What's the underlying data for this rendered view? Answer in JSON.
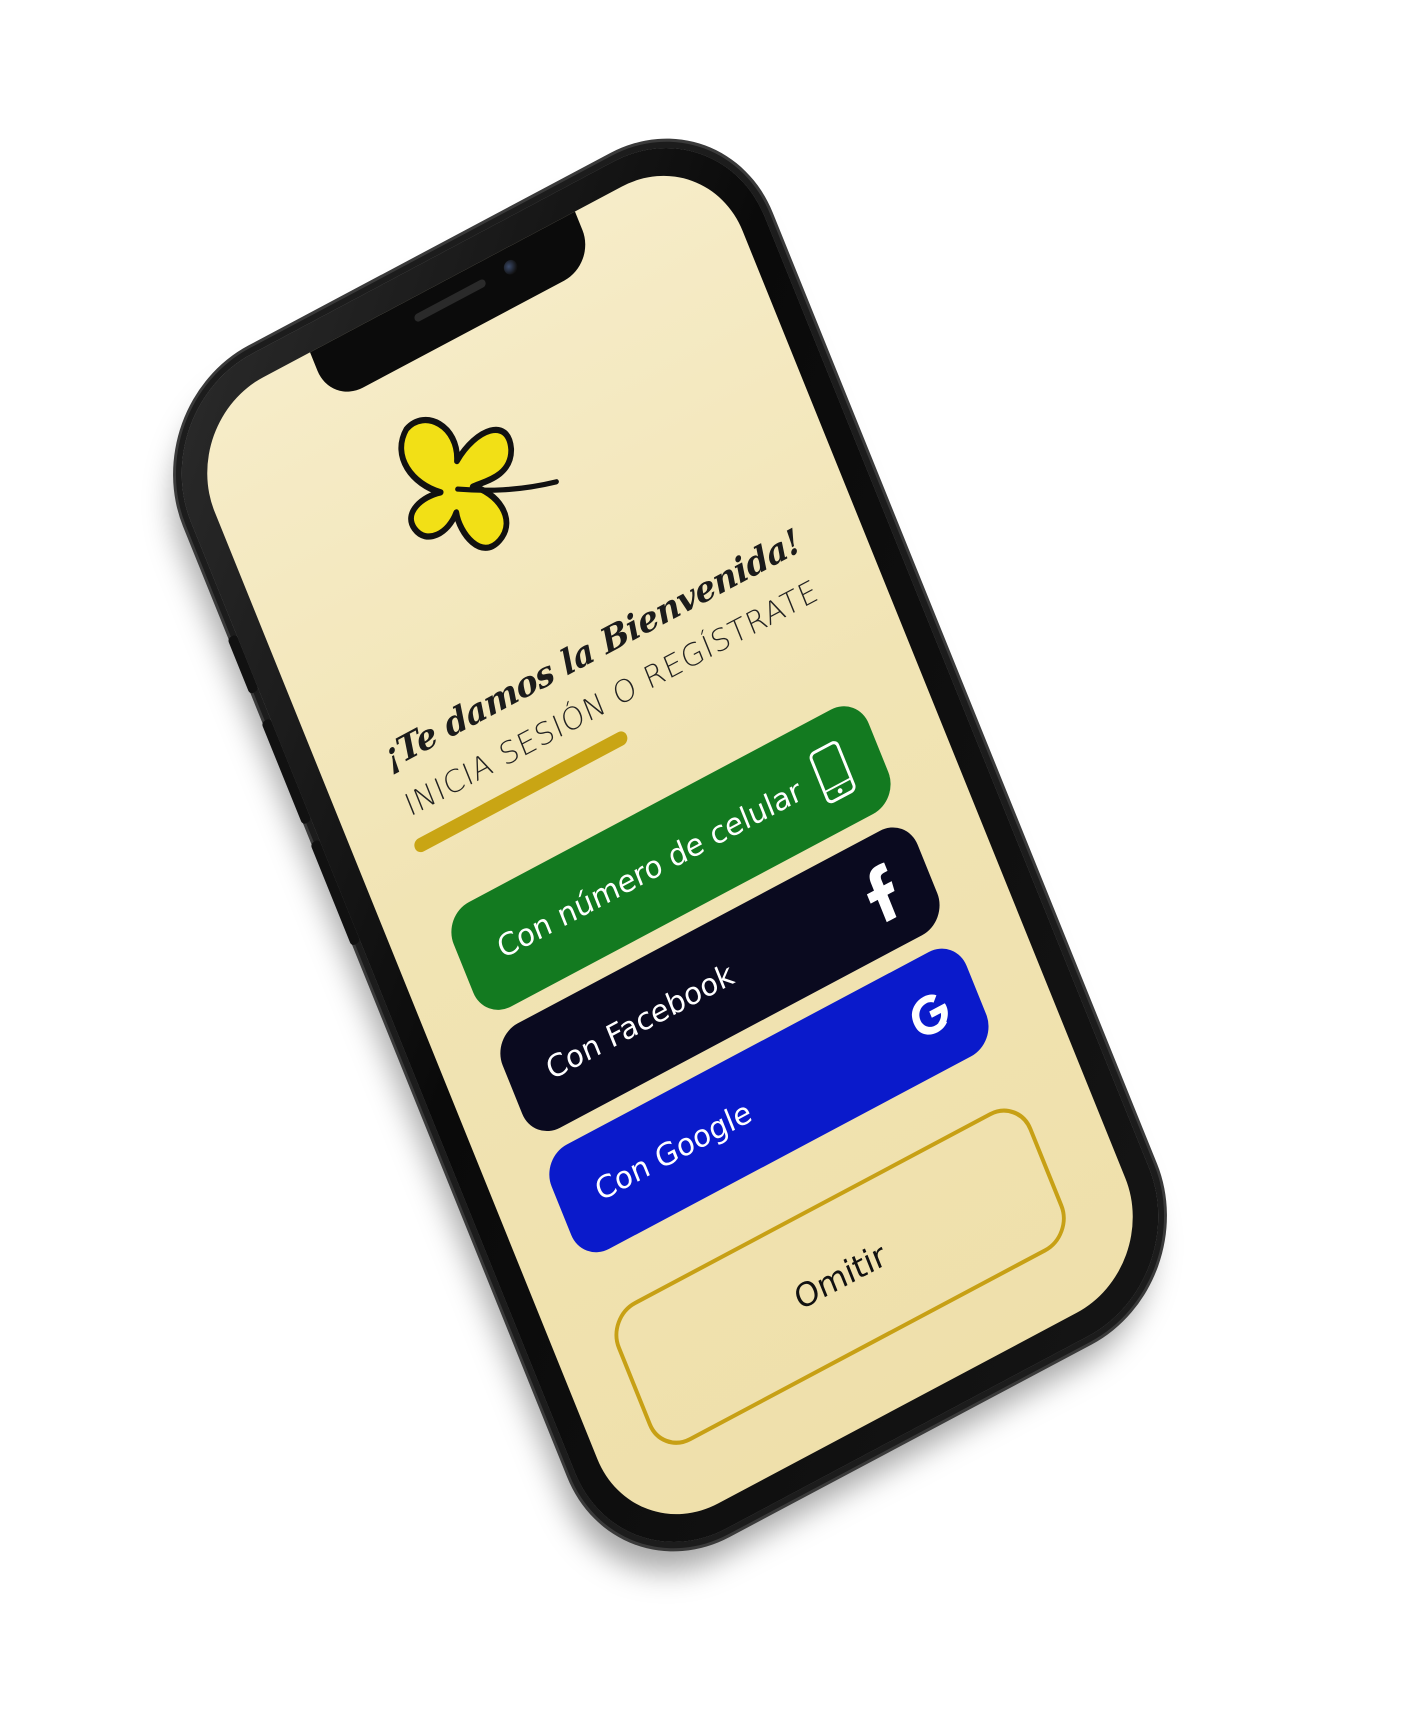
{
  "welcome": {
    "title": "¡Te damos la Bienvenida!",
    "subtitle": "INICIA SESIÓN O REGÍSTRATE"
  },
  "buttons": {
    "phone_label": "Con número de celular",
    "facebook_label": "Con Facebook",
    "google_label": "Con Google",
    "skip_label": "Omitir"
  },
  "colors": {
    "accent": "#c9a514",
    "phone_button": "#137a20",
    "facebook_button": "#0a0a1f",
    "google_button": "#0a1acb",
    "background": "#f1e4b4"
  },
  "icons": {
    "logo": "yellow-flower-logo",
    "phone": "mobile-phone-icon",
    "facebook": "facebook-icon",
    "google": "google-icon"
  }
}
